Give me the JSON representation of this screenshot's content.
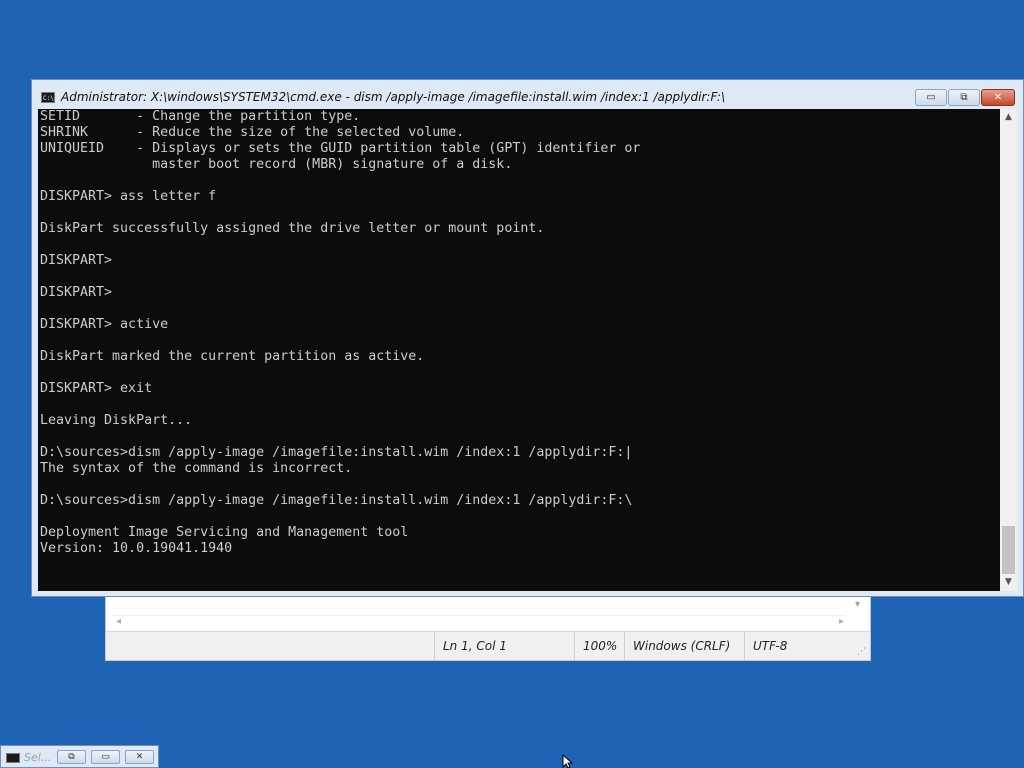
{
  "cmd_window": {
    "title": "Administrator: X:\\windows\\SYSTEM32\\cmd.exe - dism  /apply-image /imagefile:install.wim /index:1 /applydir:F:\\",
    "icon_label": "C:\\.",
    "minimize_symbol": "▭",
    "maximize_symbol": "⧉",
    "close_symbol": "✕",
    "console_lines": "SETID       - Change the partition type.\nSHRINK      - Reduce the size of the selected volume.\nUNIQUEID    - Displays or sets the GUID partition table (GPT) identifier or\n              master boot record (MBR) signature of a disk.\n\nDISKPART> ass letter f\n\nDiskPart successfully assigned the drive letter or mount point.\n\nDISKPART>\n\nDISKPART>\n\nDISKPART> active\n\nDiskPart marked the current partition as active.\n\nDISKPART> exit\n\nLeaving DiskPart...\n\nD:\\sources>dism /apply-image /imagefile:install.wim /index:1 /applydir:F:|\nThe syntax of the command is incorrect.\n\nD:\\sources>dism /apply-image /imagefile:install.wim /index:1 /applydir:F:\\\n\nDeployment Image Servicing and Management tool\nVersion: 10.0.19041.1940\n",
    "scroll_up": "▲",
    "scroll_down": "▼"
  },
  "notepad": {
    "status": {
      "position": "Ln 1, Col 1",
      "zoom": "100%",
      "line_endings": "Windows (CRLF)",
      "encoding": "UTF-8"
    }
  },
  "mini_window": {
    "title": "Sel..."
  }
}
